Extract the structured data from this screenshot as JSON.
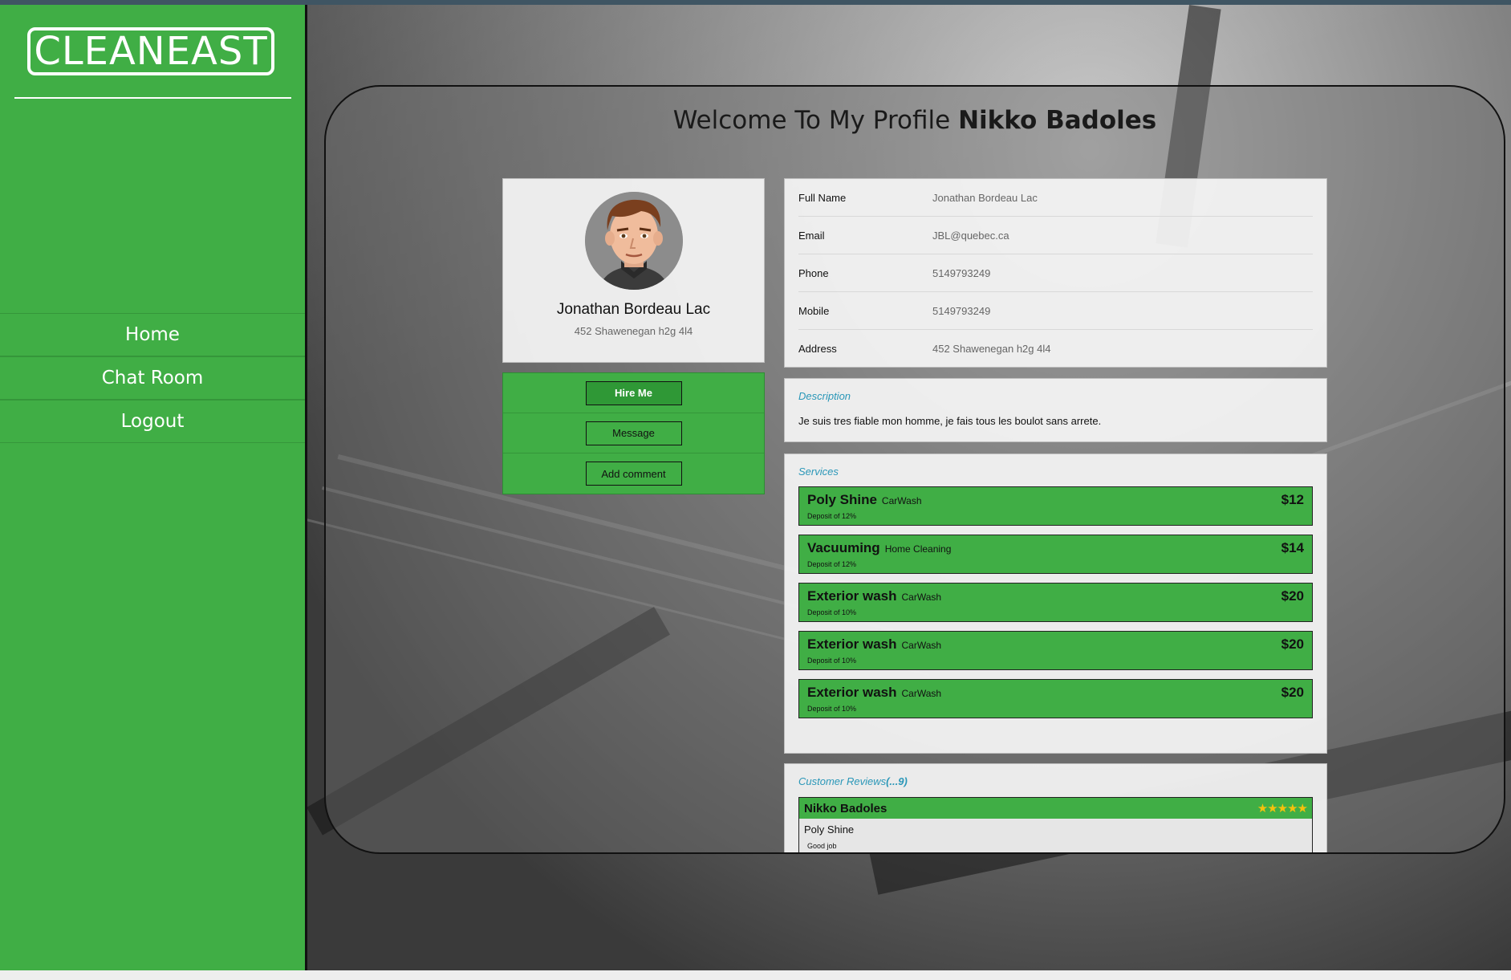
{
  "brand": {
    "logo_text": "CLEANEAST",
    "accent_color": "#40ae45"
  },
  "nav": {
    "items": [
      {
        "label": "Home"
      },
      {
        "label": "Chat Room"
      },
      {
        "label": "Logout"
      }
    ]
  },
  "header": {
    "welcome_prefix": "Welcome To My Profile",
    "viewer_name": "Nikko Badoles"
  },
  "profile": {
    "name": "Jonathan Bordeau Lac",
    "address": "452 Shawenegan h2g 4l4",
    "avatar_icon": "cartoon-man-avatar"
  },
  "actions": {
    "hire_label": "Hire Me",
    "message_label": "Message",
    "comment_label": "Add comment"
  },
  "info": {
    "rows": [
      {
        "label": "Full Name",
        "value": "Jonathan Bordeau Lac"
      },
      {
        "label": "Email",
        "value": "JBL@quebec.ca"
      },
      {
        "label": "Phone",
        "value": "5149793249"
      },
      {
        "label": "Mobile",
        "value": "5149793249"
      },
      {
        "label": "Address",
        "value": "452 Shawenegan h2g 4l4"
      }
    ]
  },
  "description": {
    "title": "Description",
    "text": "Je suis tres fiable mon homme, je fais tous les boulot sans arrete."
  },
  "services": {
    "title": "Services",
    "items": [
      {
        "name": "Poly Shine",
        "category": "CarWash",
        "price": "$12",
        "deposit": "Deposit of 12%"
      },
      {
        "name": "Vacuuming",
        "category": "Home Cleaning",
        "price": "$14",
        "deposit": "Deposit of 12%"
      },
      {
        "name": "Exterior wash",
        "category": "CarWash",
        "price": "$20",
        "deposit": "Deposit of 10%"
      },
      {
        "name": "Exterior wash",
        "category": "CarWash",
        "price": "$20",
        "deposit": "Deposit of 10%"
      },
      {
        "name": "Exterior wash",
        "category": "CarWash",
        "price": "$20",
        "deposit": "Deposit of 10%"
      }
    ]
  },
  "reviews": {
    "title": "Customer Reviews",
    "count_label": "(...9)",
    "items": [
      {
        "reviewer": "Nikko Badoles",
        "stars": "★★★★★",
        "service": "Poly Shine",
        "text": "Good job"
      }
    ]
  }
}
